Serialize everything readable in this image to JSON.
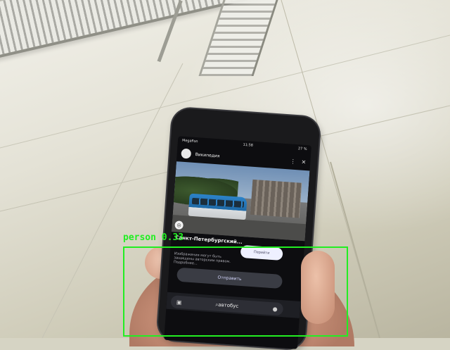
{
  "scene": {
    "description_icons": {
      "cable_tray": "cable-tray",
      "phone": "smartphone"
    }
  },
  "phone": {
    "statusbar": {
      "carrier": "MegaFon",
      "time": "11:58",
      "battery": "27 %"
    },
    "header": {
      "title": "Википедия"
    },
    "card": {
      "title": "Санкт-Петербургский...",
      "description": "Изображения могут быть защищены авторским правом. Подробнее...",
      "open_label": "Перейти",
      "send_label": "Отправить"
    },
    "search": {
      "value": "автобус"
    }
  },
  "detection": {
    "label": "person",
    "score": "0.33",
    "color": "#22ee22"
  }
}
